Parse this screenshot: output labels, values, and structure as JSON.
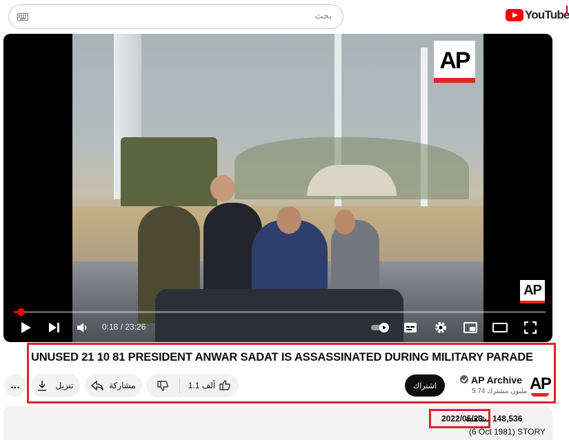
{
  "header": {
    "search_placeholder": "بحث",
    "logo_text": "YouTube"
  },
  "player": {
    "time_current": "0:18",
    "time_total": "23:26",
    "time_display": "0:18 / 23:26",
    "progress_fraction": 0.013,
    "watermark_text": "AP"
  },
  "video": {
    "title": "UNUSED 21 10 81 PRESIDENT ANWAR SADAT IS ASSASSINATED DURING MILITARY PARADE"
  },
  "actions": {
    "more_label": "...",
    "download_label": "تنزيل",
    "share_label": "مشاركة",
    "like_count": "1.1 ألف"
  },
  "channel": {
    "name": "AP Archive",
    "subscribers": "5.74 مليون مشترك",
    "subscribe_label": "اشتراك",
    "avatar_text": "AP"
  },
  "description": {
    "views_count": "148,536",
    "views_word": "مشاهدة",
    "date": "2022/05/23",
    "story_line": "(6 Oct 1981) STORY"
  },
  "colors": {
    "accent_red": "#ff0000",
    "highlight_red": "#d9232e",
    "ap_red": "#e0261b"
  }
}
